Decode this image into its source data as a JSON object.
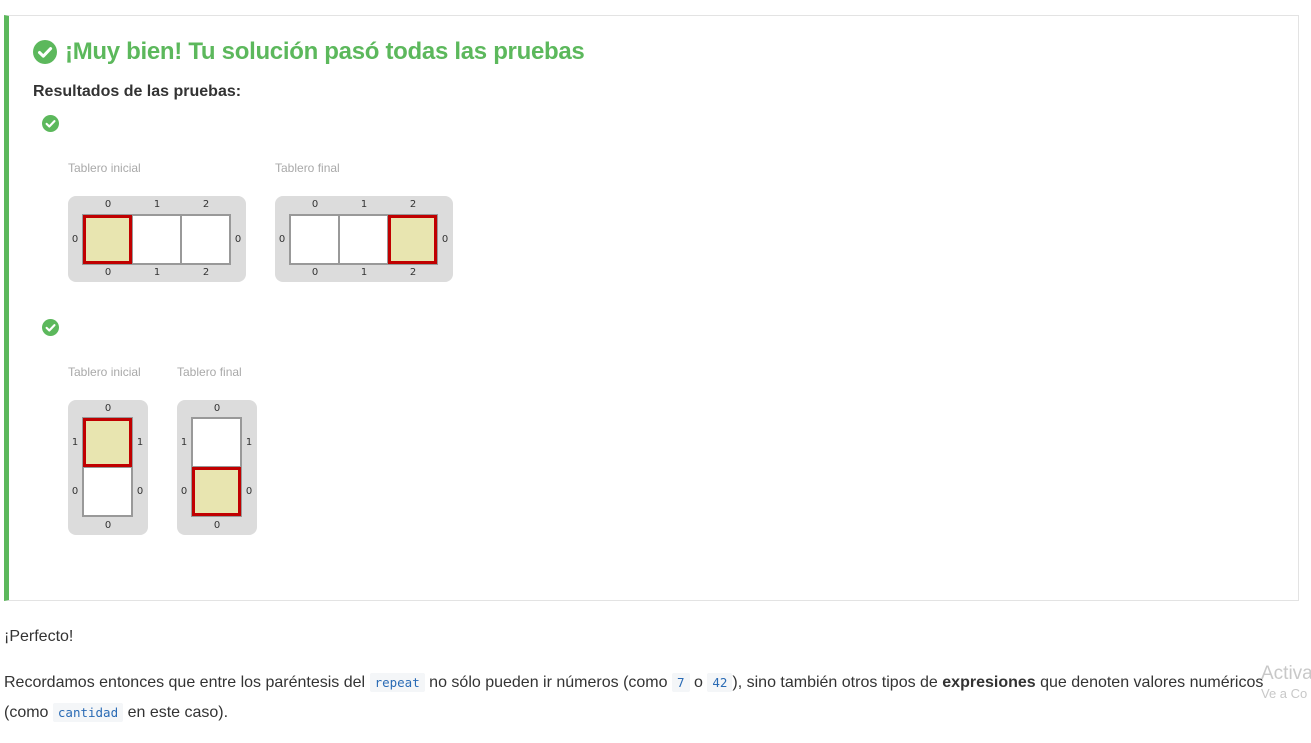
{
  "result": {
    "title": "¡Muy bien! Tu solución pasó todas las pruebas",
    "subtitle": "Resultados de las pruebas:",
    "status_color": "#5cb85c",
    "tests": [
      {
        "status": "check-circle-icon",
        "initial_label": "Tablero inicial",
        "final_label": "Tablero final",
        "initial": {
          "cols": [
            "0",
            "1",
            "2"
          ],
          "rows": [
            "0"
          ],
          "head": "0,0"
        },
        "final": {
          "cols": [
            "0",
            "1",
            "2"
          ],
          "rows": [
            "0"
          ],
          "head": "2,0"
        }
      },
      {
        "status": "check-circle-icon",
        "initial_label": "Tablero inicial",
        "final_label": "Tablero final",
        "initial": {
          "cols": [
            "0"
          ],
          "rows": [
            "1",
            "0"
          ],
          "head": "0,1"
        },
        "final": {
          "cols": [
            "0"
          ],
          "rows": [
            "1",
            "0"
          ],
          "head": "0,0"
        }
      }
    ]
  },
  "explanation": {
    "p1": "¡Perfecto!",
    "p2_a": "Recordamos entonces que entre los paréntesis del",
    "code_repeat": "repeat",
    "p2_b": "no sólo pueden ir números (como",
    "code_7": "7",
    "p2_c": "o",
    "code_42": "42",
    "p2_d": "), sino también otros tipos de",
    "p2_bold": "expresiones",
    "p2_e": "que denoten valores numéricos",
    "p3_a": "(como",
    "code_cantidad": "cantidad",
    "p3_b": "en este caso)."
  },
  "watermark": {
    "line1": "Activa",
    "line2": "Ve a Co"
  }
}
